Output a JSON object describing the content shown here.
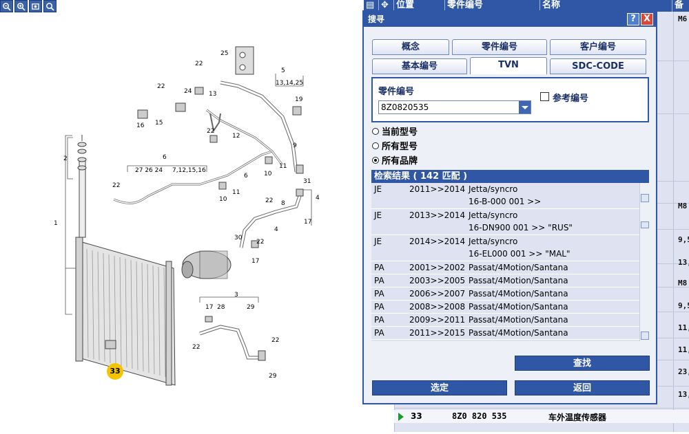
{
  "toolbar": {
    "icons": [
      "zoom-out-icon",
      "zoom-in-icon",
      "zoom-fit-icon",
      "zoom-search-icon"
    ]
  },
  "table": {
    "headers": [
      "位置",
      "零件编号",
      "名称",
      "备"
    ],
    "cells_right": [
      "M6",
      "M8",
      "9,5",
      "13,",
      "M8",
      "9,5",
      "11,",
      "11,",
      "23,",
      "13,"
    ],
    "selected_row": {
      "pos": "33",
      "part_no": "8Z0 820 535",
      "name": "车外温度传感器"
    }
  },
  "dialog": {
    "title": "搜寻",
    "help_label": "?",
    "close_label": "X",
    "tabs_row1": [
      "概念",
      "零件编号",
      "客户编号"
    ],
    "tabs_row2": [
      "基本编号",
      "TVN",
      "SDC-CODE"
    ],
    "search_label": "零件编号",
    "search_value": "8Z0820535",
    "ref_checkbox_label": "参考编号",
    "radios": [
      {
        "label": "当前型号",
        "selected": false
      },
      {
        "label": "所有型号",
        "selected": false
      },
      {
        "label": "所有品牌",
        "selected": true
      }
    ],
    "results_header": "检索结果 ( 142 匹配 )",
    "results": [
      {
        "code": "JE",
        "years": "2011>>2014",
        "model": "Jetta/syncro",
        "detail": "16-B-000 001 >>"
      },
      {
        "code": "JE",
        "years": "2013>>2014",
        "model": "Jetta/syncro",
        "detail": "16-DN900 001 >> \"RUS\""
      },
      {
        "code": "JE",
        "years": "2014>>2014",
        "model": "Jetta/syncro",
        "detail": "16-EL000 001 >> \"MAL\""
      },
      {
        "code": "PA",
        "years": "2001>>2002",
        "model": "Passat/4Motion/Santana",
        "detail": ""
      },
      {
        "code": "PA",
        "years": "2003>>2005",
        "model": "Passat/4Motion/Santana",
        "detail": ""
      },
      {
        "code": "PA",
        "years": "2006>>2007",
        "model": "Passat/4Motion/Santana",
        "detail": ""
      },
      {
        "code": "PA",
        "years": "2008>>2008",
        "model": "Passat/4Motion/Santana",
        "detail": ""
      },
      {
        "code": "PA",
        "years": "2009>>2011",
        "model": "Passat/4Motion/Santana",
        "detail": ""
      },
      {
        "code": "PA",
        "years": "2011>>2015",
        "model": "Passat/4Motion/Santana",
        "detail": ""
      }
    ],
    "find_button": "查找",
    "select_button": "选定",
    "back_button": "返回"
  },
  "diagram": {
    "labels": [
      "25",
      "22",
      "24",
      "13",
      "5",
      "13,14,25",
      "22",
      "19",
      "16",
      "15",
      "2",
      "22",
      "12",
      "6",
      "27 26 24",
      "7,12,15,16",
      "11",
      "10",
      "22",
      "10",
      "11",
      "6",
      "31",
      "4",
      "22",
      "8",
      "17",
      "1",
      "30",
      "22",
      "17",
      "3",
      "17",
      "28",
      "29",
      "22",
      "22",
      "29",
      "4",
      "9",
      "33"
    ],
    "callout": "33"
  }
}
